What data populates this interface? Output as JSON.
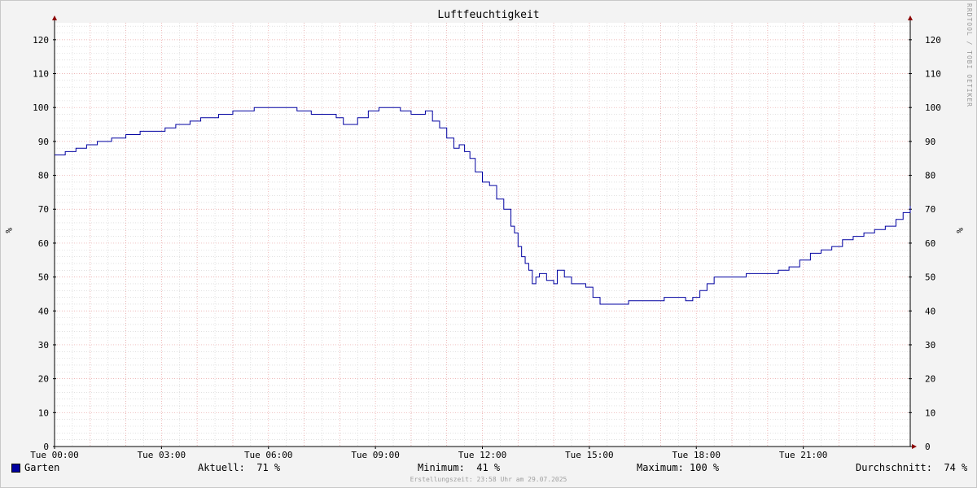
{
  "watermark": "RRDTOOL / TOBI OETIKER",
  "legend": {
    "current": "Aktuell:  71 %",
    "minimum": "Minimum:  41 %",
    "maximum": "Maximum: 100 %",
    "average": "Durchschnitt:  74 %"
  },
  "footer": "Erstellungszeit: 23:58 Uhr am 29.07.2025",
  "colors": {
    "series": "#0000a0",
    "major_grid": "#e8a0a0",
    "minor_grid": "#cfcfcf",
    "axis": "#000000",
    "arrow": "#8b0000"
  },
  "chart_data": {
    "type": "line",
    "title": "Luftfeuchtigkeit",
    "xlabel": "",
    "ylabel": "%",
    "ylim": [
      0,
      125
    ],
    "yticks": [
      0,
      10,
      20,
      30,
      40,
      50,
      60,
      70,
      80,
      90,
      100,
      110,
      120
    ],
    "xlim_hours": [
      0,
      24
    ],
    "xticks": [
      {
        "hour": 0,
        "label": "Tue 00:00"
      },
      {
        "hour": 3,
        "label": "Tue 03:00"
      },
      {
        "hour": 6,
        "label": "Tue 06:00"
      },
      {
        "hour": 9,
        "label": "Tue 09:00"
      },
      {
        "hour": 12,
        "label": "Tue 12:00"
      },
      {
        "hour": 15,
        "label": "Tue 15:00"
      },
      {
        "hour": 18,
        "label": "Tue 18:00"
      },
      {
        "hour": 21,
        "label": "Tue 21:00"
      }
    ],
    "grid": true,
    "legend_position": "bottom",
    "series": [
      {
        "name": "Garten",
        "color": "#0000a0",
        "x_hours": [
          0,
          0.1,
          0.3,
          0.6,
          0.9,
          1.2,
          1.6,
          2.0,
          2.4,
          2.8,
          3.1,
          3.4,
          3.8,
          4.1,
          4.6,
          5.0,
          5.6,
          6.0,
          6.4,
          6.8,
          7.2,
          7.6,
          7.9,
          8.1,
          8.3,
          8.5,
          8.8,
          9.1,
          9.5,
          9.7,
          10.0,
          10.2,
          10.4,
          10.6,
          10.8,
          11.0,
          11.2,
          11.35,
          11.5,
          11.65,
          11.8,
          12.0,
          12.2,
          12.4,
          12.6,
          12.8,
          12.9,
          13.0,
          13.1,
          13.2,
          13.3,
          13.4,
          13.5,
          13.6,
          13.8,
          14.0,
          14.1,
          14.3,
          14.5,
          14.7,
          14.9,
          15.1,
          15.3,
          15.5,
          15.7,
          15.9,
          16.1,
          16.3,
          16.5,
          16.8,
          17.1,
          17.4,
          17.7,
          17.9,
          18.1,
          18.3,
          18.5,
          18.8,
          19.1,
          19.4,
          19.7,
          20.0,
          20.3,
          20.6,
          20.9,
          21.2,
          21.5,
          21.8,
          22.1,
          22.4,
          22.7,
          23.0,
          23.3,
          23.6,
          23.8,
          24.0
        ],
        "values": [
          86,
          86,
          87,
          88,
          89,
          90,
          91,
          92,
          93,
          93,
          94,
          95,
          96,
          97,
          98,
          99,
          100,
          100,
          100,
          99,
          98,
          98,
          97,
          95,
          95,
          97,
          99,
          100,
          100,
          99,
          98,
          98,
          99,
          96,
          94,
          91,
          88,
          89,
          87,
          85,
          81,
          78,
          77,
          73,
          70,
          65,
          63,
          59,
          56,
          54,
          52,
          48,
          50,
          51,
          49,
          48,
          52,
          50,
          48,
          48,
          47,
          44,
          42,
          42,
          42,
          42,
          43,
          43,
          43,
          43,
          44,
          44,
          43,
          44,
          46,
          48,
          50,
          50,
          50,
          51,
          51,
          51,
          52,
          53,
          55,
          57,
          58,
          59,
          61,
          62,
          63,
          64,
          65,
          67,
          69,
          71
        ]
      }
    ]
  }
}
